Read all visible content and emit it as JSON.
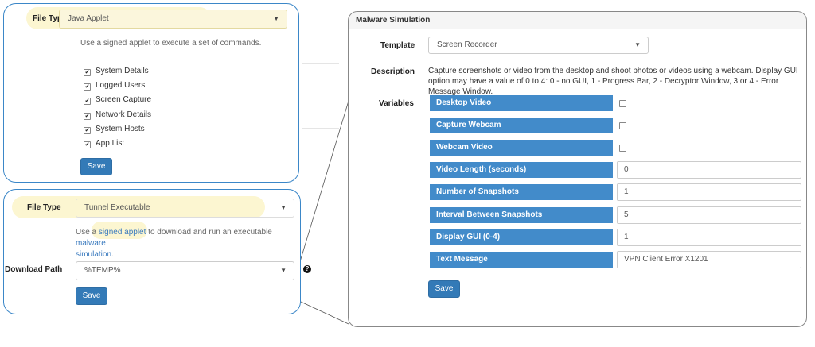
{
  "applet_panel": {
    "file_type_label": "File Type",
    "file_type_value": "Java Applet",
    "help": "Use a signed applet to execute a set of commands.",
    "checks": [
      {
        "label": "System Details",
        "checked": true
      },
      {
        "label": "Logged Users",
        "checked": true
      },
      {
        "label": "Screen Capture",
        "checked": true
      },
      {
        "label": "Network Details",
        "checked": true
      },
      {
        "label": "System Hosts",
        "checked": true
      },
      {
        "label": "App List",
        "checked": true
      }
    ],
    "save_label": "Save"
  },
  "tunnel_panel": {
    "file_type_label": "File Type",
    "file_type_value": "Tunnel Executable",
    "help_1": "Use a ",
    "help_link_1": "signed applet",
    "help_2": " to download and run an executable ",
    "help_link_2": "malware",
    "help_link_3": "simulation",
    "help_end": ".",
    "download_path_label": "Download Path",
    "download_path_value": "%TEMP%",
    "help_icon_glyph": "?",
    "save_label": "Save"
  },
  "malware_panel": {
    "title": "Malware Simulation",
    "template_label": "Template",
    "template_value": "Screen Recorder",
    "description_label": "Description",
    "description": "Capture screenshots or video from the desktop and shoot photos or videos using a webcam. Display GUI option may have a value of 0 to 4: 0 - no GUI, 1 - Progress Bar, 2 - Decryptor Window, 3 or 4 - Error Message Window.",
    "variables_label": "Variables",
    "variables": [
      {
        "name": "Desktop Video",
        "kind": "checkbox",
        "value": ""
      },
      {
        "name": "Capture Webcam",
        "kind": "checkbox",
        "value": ""
      },
      {
        "name": "Webcam Video",
        "kind": "checkbox",
        "value": ""
      },
      {
        "name": "Video Length (seconds)",
        "kind": "text",
        "value": "0"
      },
      {
        "name": "Number of Snapshots",
        "kind": "text",
        "value": "1"
      },
      {
        "name": "Interval Between Snapshots",
        "kind": "text",
        "value": "5"
      },
      {
        "name": "Display GUI (0-4)",
        "kind": "text",
        "value": "1"
      },
      {
        "name": "Text Message",
        "kind": "text",
        "value": "VPN Client Error X1201"
      }
    ],
    "save_label": "Save"
  },
  "colors": {
    "panel_border": "#3b87c8",
    "primary_button": "#337ab7",
    "variable_label_bg": "#428bca",
    "highlight": "#fcf5cc"
  }
}
